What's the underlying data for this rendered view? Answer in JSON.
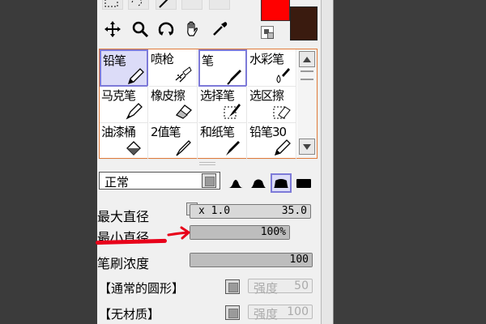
{
  "colors": {
    "foreground": "#ff0000",
    "background": "#3a1b0f",
    "accent": "#7d7ad8",
    "frame": "#e07a3a",
    "annotation": "#e8001a"
  },
  "tools": [
    "marquee-icon",
    "lasso-icon",
    "magic-wand-icon",
    "move-icon",
    "zoom-icon",
    "rotate-icon",
    "hand-icon",
    "eyedropper-icon"
  ],
  "brushes": [
    {
      "label": "铅笔",
      "icon": "pencil-icon"
    },
    {
      "label": "喷枪",
      "icon": "airbrush-icon"
    },
    {
      "label": "笔",
      "icon": "pen-icon"
    },
    {
      "label": "水彩笔",
      "icon": "watercolor-icon"
    },
    {
      "label": "马克笔",
      "icon": "marker-icon"
    },
    {
      "label": "橡皮擦",
      "icon": "eraser-icon"
    },
    {
      "label": "选择笔",
      "icon": "select-pen-icon"
    },
    {
      "label": "选区擦",
      "icon": "select-eraser-icon"
    },
    {
      "label": "油漆桶",
      "icon": "bucket-icon"
    },
    {
      "label": "2值笔",
      "icon": "binary-pen-icon"
    },
    {
      "label": "和纸笔",
      "icon": "washi-pen-icon"
    },
    {
      "label": "铅笔30",
      "icon": "pencil-icon"
    }
  ],
  "blend_mode": {
    "value": "正常"
  },
  "settings": {
    "max_size": {
      "label": "最大直径",
      "multiplier": "x 1.0",
      "value": "35.0"
    },
    "min_size": {
      "label": "最小直径",
      "value": "100%",
      "fraction": 1.0
    },
    "density": {
      "label": "笔刷浓度",
      "value": "100",
      "fraction": 1.0
    },
    "shape": {
      "value": "【通常的圆形】",
      "strength_label": "强度",
      "strength_value": "50"
    },
    "texture": {
      "value": "【无材质】",
      "strength_label": "强度",
      "strength_value": "100"
    }
  }
}
